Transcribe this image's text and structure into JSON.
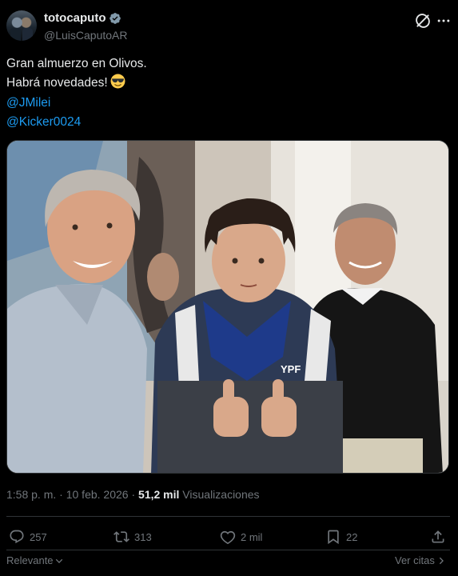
{
  "author": {
    "display_name": "totocaputo",
    "handle": "@LuisCaputoAR",
    "verified_icon": "verified-badge-icon"
  },
  "tweet": {
    "lines": [
      "Gran almuerzo en Olivos.",
      "Habrá novedades!"
    ],
    "emoji": "smiling-face-with-sunglasses",
    "mentions": [
      "@JMilei",
      "@Kicker0024"
    ],
    "image_alt": "Photo"
  },
  "meta": {
    "time": "1:58 p. m.",
    "separator": "·",
    "date": "10 feb. 2026",
    "views_count": "51,2 mil",
    "views_label": "Visualizaciones"
  },
  "actions": {
    "replies": "257",
    "reposts": "313",
    "likes": "2 mil",
    "bookmarks": "22"
  },
  "footer": {
    "sort_label": "Relevante",
    "quotes_label": "Ver citas"
  },
  "colors": {
    "background": "#000000",
    "text": "#e7e9ea",
    "muted": "#71767b",
    "link": "#1d9bf0",
    "border": "#2f3336"
  }
}
